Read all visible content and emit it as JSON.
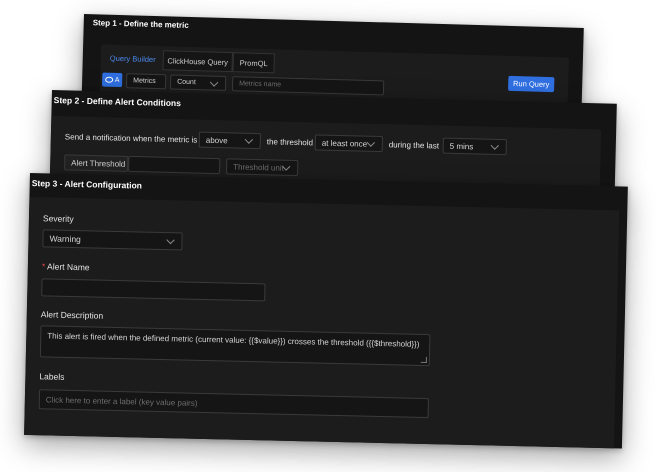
{
  "step1": {
    "title": "Step 1 - Define the metric",
    "tabs": [
      "Query Builder",
      "ClickHouse Query",
      "PromQL"
    ],
    "query_label": "A",
    "data_source": "Metrics",
    "aggregation": "Count",
    "metric_placeholder": "Metrics name",
    "run_query_label": "Run Query",
    "close_icon": "close-circle-icon"
  },
  "step2": {
    "title": "Step 2 - Define Alert Conditions",
    "text_notify": "Send a notification when the metric is",
    "condition": "above",
    "text_threshold": "the threshold",
    "match": "at least once",
    "text_during": "during the last",
    "duration": "5 mins",
    "alert_threshold_label": "Alert Threshold",
    "threshold_unit_placeholder": "Threshold unit"
  },
  "step3": {
    "title": "Step 3 - Alert Configuration",
    "severity_label": "Severity",
    "severity_value": "Warning",
    "required_mark": "*",
    "alert_name_label": "Alert Name",
    "alert_description_label": "Alert Description",
    "alert_description_value": "This alert is fired when the defined metric (current value: {{$value}}) crosses the threshold ({{$threshold}})",
    "labels_label": "Labels",
    "labels_placeholder": "Click here to enter a label (key value pairs)"
  },
  "colors": {
    "accent": "#2f6fe0",
    "required": "#e5484d",
    "card_bg": "#141414"
  }
}
